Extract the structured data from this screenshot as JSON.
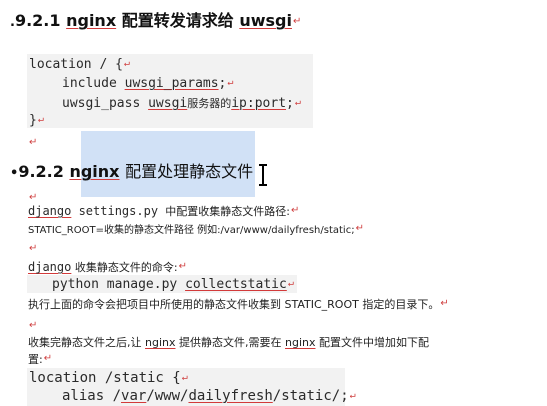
{
  "section1": {
    "number": "9.2.1",
    "title_prefix": "nginx",
    "title_cn": "配置转发请求给",
    "title_suffix": "uwsgi"
  },
  "code1": {
    "line1": "location / {",
    "line2_kw": "include ",
    "line2_val": "uwsgi_params",
    "line2_end": ";",
    "line3_a": "uwsgi_pass ",
    "line3_b": "uwsgi",
    "line3_c": "服务器的",
    "line3_d": "ip:port",
    "line3_e": ";",
    "line4": "}"
  },
  "section2": {
    "number": "9.2.2",
    "title_prefix": "nginx",
    "title_cn": "配置处理静态文件"
  },
  "para1": {
    "a1": "django",
    "a2": " settings.py ",
    "a3": "中配置收集静态文件路径:",
    "b": "STATIC_ROOT=收集的静态文件路径 例如:/var/www/dailyfresh/static;"
  },
  "para2": {
    "a1": "django",
    "a2": " 收集静态文件的命令:",
    "cmd1": "python manage.py ",
    "cmd2": "collectstatic",
    "desc": "执行上面的命令会把项目中所使用的静态文件收集到 STATIC_ROOT 指定的目录下。"
  },
  "para3": {
    "a": "收集完静态文件之后,让 ",
    "b": "nginx",
    "c": " 提供静态文件,需要在 ",
    "d": "nginx",
    "e": " 配置文件中增加如下配",
    "f": "置:"
  },
  "code2": {
    "line1": "location /static {",
    "line2_a": "alias /",
    "line2_b": "var",
    "line2_c": "/www/",
    "line2_d": "dailyfresh",
    "line2_e": "/static/;"
  },
  "marks": {
    "return": "↵"
  }
}
